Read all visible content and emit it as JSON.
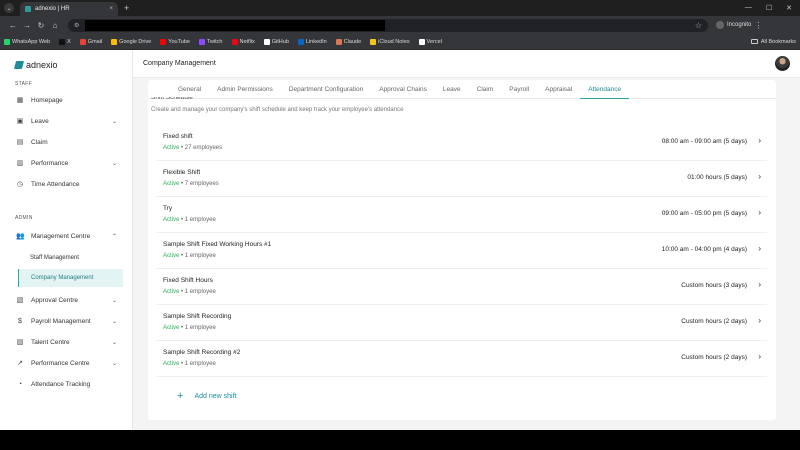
{
  "browser": {
    "tab_title": "adnexio | HR",
    "tab_close": "×",
    "new_tab": "+",
    "incognito_label": "Incognito",
    "bookmarks": [
      {
        "label": "WhatsApp Web",
        "color": "#25d366"
      },
      {
        "label": "X",
        "color": "#111111"
      },
      {
        "label": "Gmail",
        "color": "#ea4335"
      },
      {
        "label": "Google Drive",
        "color": "#fbbc04"
      },
      {
        "label": "YouTube",
        "color": "#ff0000"
      },
      {
        "label": "Twitch",
        "color": "#9146ff"
      },
      {
        "label": "Netflix",
        "color": "#e50914"
      },
      {
        "label": "GitHub",
        "color": "#ffffff"
      },
      {
        "label": "LinkedIn",
        "color": "#0a66c2"
      },
      {
        "label": "Claude",
        "color": "#d97757"
      },
      {
        "label": "iCloud Notes",
        "color": "#f5c518"
      },
      {
        "label": "Vercel",
        "color": "#ffffff"
      }
    ],
    "all_bookmarks": "All Bookmarks"
  },
  "sidebar": {
    "brand": "adnexio",
    "staff_label": "STAFF",
    "admin_label": "ADMIN",
    "staff_items": [
      {
        "label": "Homepage",
        "icon": "grid-icon",
        "chevron": ""
      },
      {
        "label": "Leave",
        "icon": "calendar-icon",
        "chevron": "⌄"
      },
      {
        "label": "Claim",
        "icon": "receipt-icon",
        "chevron": ""
      },
      {
        "label": "Performance",
        "icon": "chart-icon",
        "chevron": "⌄"
      },
      {
        "label": "Time Attendance",
        "icon": "stopwatch-icon",
        "chevron": ""
      }
    ],
    "management_centre": "Management Centre",
    "sub_items": [
      "Staff Management",
      "Company Management"
    ],
    "admin_items": [
      {
        "label": "Approval Centre",
        "icon": "document-check-icon",
        "chevron": "⌄"
      },
      {
        "label": "Payroll Management",
        "icon": "dollar-icon",
        "chevron": "⌄"
      },
      {
        "label": "Talent Centre",
        "icon": "briefcase-icon",
        "chevron": "⌄"
      },
      {
        "label": "Performance Centre",
        "icon": "trend-icon",
        "chevron": "⌄"
      },
      {
        "label": "Attendance Tracking",
        "icon": "clock-icon",
        "chevron": ""
      }
    ]
  },
  "header": {
    "title": "Company Management"
  },
  "tabs": [
    "General",
    "Admin Permissions",
    "Department Configuration",
    "Approval Chains",
    "Leave",
    "Claim",
    "Payroll",
    "Appraisal",
    "Attendance"
  ],
  "active_tab": "Attendance",
  "section": {
    "title": "Shift Schedule",
    "description": "Create and manage your company's shift schedule and keep track your employee's attendance"
  },
  "shifts": [
    {
      "name": "Fixed shift",
      "status": "Active",
      "employees": "• 27 employees",
      "hours": "08:00 am - 09:00 am (5 days)"
    },
    {
      "name": "Flexible Shift",
      "status": "Active",
      "employees": "• 7 employees",
      "hours": "01:00 hours (5 days)"
    },
    {
      "name": "Try",
      "status": "Active",
      "employees": "• 1 employee",
      "hours": "09:00 am - 05:00 pm (5 days)"
    },
    {
      "name": "Sample Shift Fixed Working Hours #1",
      "status": "Active",
      "employees": "• 1 employee",
      "hours": "10:00 am - 04:00 pm (4 days)"
    },
    {
      "name": "Fixed Shift Hours",
      "status": "Active",
      "employees": "• 1 employee",
      "hours": "Custom hours (3 days)"
    },
    {
      "name": "Sample Shift Recording",
      "status": "Active",
      "employees": "• 1 employee",
      "hours": "Custom hours (2 days)"
    },
    {
      "name": "Sample Shift Recording #2",
      "status": "Active",
      "employees": "• 1 employee",
      "hours": "Custom hours (2 days)"
    }
  ],
  "add_shift": {
    "plus": "+",
    "label": "Add new shift"
  },
  "colors": {
    "accent": "#2aa8a8",
    "active_status": "#27b35a"
  }
}
